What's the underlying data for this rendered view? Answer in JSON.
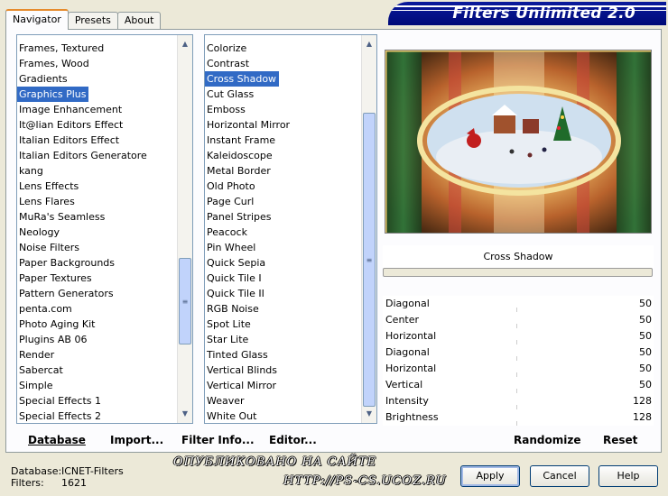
{
  "tabs": [
    "Navigator",
    "Presets",
    "About"
  ],
  "banner_title": "Filters Unlimited 2.0",
  "categories": [
    "Frames, Textured",
    "Frames, Wood",
    "Gradients",
    "Graphics Plus",
    "Image Enhancement",
    "It@lian Editors Effect",
    "Italian Editors Effect",
    "Italian Editors Generatore",
    "kang",
    "Lens Effects",
    "Lens Flares",
    "MuRa's Seamless",
    "Neology",
    "Noise Filters",
    "Paper Backgrounds",
    "Paper Textures",
    "Pattern Generators",
    "penta.com",
    "Photo Aging Kit",
    "Plugins AB 06",
    "Render",
    "Sabercat",
    "Simple",
    "Special Effects 1",
    "Special Effects 2"
  ],
  "categories_selected": 3,
  "filters": [
    "Colorize",
    "Contrast",
    "Cross Shadow",
    "Cut Glass",
    "Emboss",
    "Horizontal Mirror",
    "Instant Frame",
    "Kaleidoscope",
    "Metal Border",
    "Old Photo",
    "Page Curl",
    "Panel Stripes",
    "Peacock",
    "Pin Wheel",
    "Quick Sepia",
    "Quick Tile I",
    "Quick Tile II",
    "RGB Noise",
    "Spot Lite",
    "Star Lite",
    "Tinted Glass",
    "Vertical Blinds",
    "Vertical Mirror",
    "Weaver",
    "White Out"
  ],
  "filters_selected": 2,
  "filter_name": "Cross Shadow",
  "params": [
    {
      "label": "Diagonal",
      "value": "50"
    },
    {
      "label": "Center",
      "value": "50"
    },
    {
      "label": "Horizontal",
      "value": "50"
    },
    {
      "label": "Diagonal",
      "value": "50"
    },
    {
      "label": "Horizontal",
      "value": "50"
    },
    {
      "label": "Vertical",
      "value": "50"
    },
    {
      "label": "Intensity",
      "value": "128"
    },
    {
      "label": "Brightness",
      "value": "128"
    }
  ],
  "actions": {
    "database": "Database",
    "import": "Import...",
    "filter_info": "Filter Info...",
    "editor": "Editor...",
    "randomize": "Randomize",
    "reset": "Reset"
  },
  "status": {
    "database_label": "Database:",
    "database_value": "ICNET-Filters",
    "filters_label": "Filters:",
    "filters_value": "1621"
  },
  "buttons": {
    "apply": "Apply",
    "cancel": "Cancel",
    "help": "Help"
  },
  "watermark": {
    "line1": "ОПУБЛИКОВАНО   НА САЙТЕ",
    "line2": "HTTP://PS-CS.UCOZ.RU"
  },
  "colors": {
    "selection": "#316ac5",
    "banner": "#0a1a9c",
    "tab_accent": "#e68b2c"
  }
}
